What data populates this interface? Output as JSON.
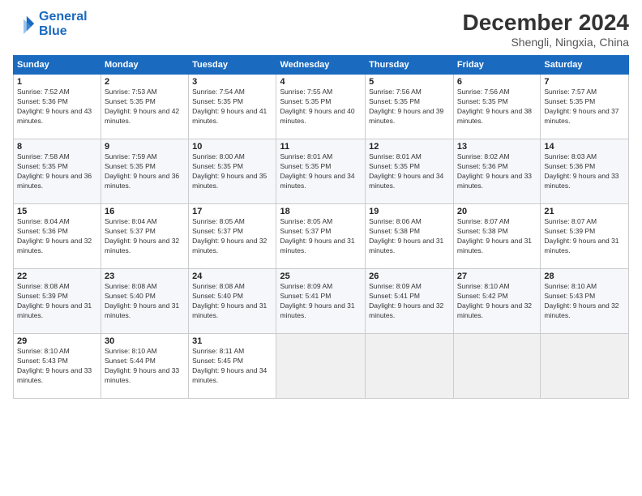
{
  "logo": {
    "line1": "General",
    "line2": "Blue"
  },
  "title": "December 2024",
  "subtitle": "Shengli, Ningxia, China",
  "days_header": [
    "Sunday",
    "Monday",
    "Tuesday",
    "Wednesday",
    "Thursday",
    "Friday",
    "Saturday"
  ],
  "weeks": [
    [
      {
        "day": "1",
        "sunrise": "7:52 AM",
        "sunset": "5:36 PM",
        "daylight": "9 hours and 43 minutes."
      },
      {
        "day": "2",
        "sunrise": "7:53 AM",
        "sunset": "5:35 PM",
        "daylight": "9 hours and 42 minutes."
      },
      {
        "day": "3",
        "sunrise": "7:54 AM",
        "sunset": "5:35 PM",
        "daylight": "9 hours and 41 minutes."
      },
      {
        "day": "4",
        "sunrise": "7:55 AM",
        "sunset": "5:35 PM",
        "daylight": "9 hours and 40 minutes."
      },
      {
        "day": "5",
        "sunrise": "7:56 AM",
        "sunset": "5:35 PM",
        "daylight": "9 hours and 39 minutes."
      },
      {
        "day": "6",
        "sunrise": "7:56 AM",
        "sunset": "5:35 PM",
        "daylight": "9 hours and 38 minutes."
      },
      {
        "day": "7",
        "sunrise": "7:57 AM",
        "sunset": "5:35 PM",
        "daylight": "9 hours and 37 minutes."
      }
    ],
    [
      {
        "day": "8",
        "sunrise": "7:58 AM",
        "sunset": "5:35 PM",
        "daylight": "9 hours and 36 minutes."
      },
      {
        "day": "9",
        "sunrise": "7:59 AM",
        "sunset": "5:35 PM",
        "daylight": "9 hours and 36 minutes."
      },
      {
        "day": "10",
        "sunrise": "8:00 AM",
        "sunset": "5:35 PM",
        "daylight": "9 hours and 35 minutes."
      },
      {
        "day": "11",
        "sunrise": "8:01 AM",
        "sunset": "5:35 PM",
        "daylight": "9 hours and 34 minutes."
      },
      {
        "day": "12",
        "sunrise": "8:01 AM",
        "sunset": "5:35 PM",
        "daylight": "9 hours and 34 minutes."
      },
      {
        "day": "13",
        "sunrise": "8:02 AM",
        "sunset": "5:36 PM",
        "daylight": "9 hours and 33 minutes."
      },
      {
        "day": "14",
        "sunrise": "8:03 AM",
        "sunset": "5:36 PM",
        "daylight": "9 hours and 33 minutes."
      }
    ],
    [
      {
        "day": "15",
        "sunrise": "8:04 AM",
        "sunset": "5:36 PM",
        "daylight": "9 hours and 32 minutes."
      },
      {
        "day": "16",
        "sunrise": "8:04 AM",
        "sunset": "5:37 PM",
        "daylight": "9 hours and 32 minutes."
      },
      {
        "day": "17",
        "sunrise": "8:05 AM",
        "sunset": "5:37 PM",
        "daylight": "9 hours and 32 minutes."
      },
      {
        "day": "18",
        "sunrise": "8:05 AM",
        "sunset": "5:37 PM",
        "daylight": "9 hours and 31 minutes."
      },
      {
        "day": "19",
        "sunrise": "8:06 AM",
        "sunset": "5:38 PM",
        "daylight": "9 hours and 31 minutes."
      },
      {
        "day": "20",
        "sunrise": "8:07 AM",
        "sunset": "5:38 PM",
        "daylight": "9 hours and 31 minutes."
      },
      {
        "day": "21",
        "sunrise": "8:07 AM",
        "sunset": "5:39 PM",
        "daylight": "9 hours and 31 minutes."
      }
    ],
    [
      {
        "day": "22",
        "sunrise": "8:08 AM",
        "sunset": "5:39 PM",
        "daylight": "9 hours and 31 minutes."
      },
      {
        "day": "23",
        "sunrise": "8:08 AM",
        "sunset": "5:40 PM",
        "daylight": "9 hours and 31 minutes."
      },
      {
        "day": "24",
        "sunrise": "8:08 AM",
        "sunset": "5:40 PM",
        "daylight": "9 hours and 31 minutes."
      },
      {
        "day": "25",
        "sunrise": "8:09 AM",
        "sunset": "5:41 PM",
        "daylight": "9 hours and 31 minutes."
      },
      {
        "day": "26",
        "sunrise": "8:09 AM",
        "sunset": "5:41 PM",
        "daylight": "9 hours and 32 minutes."
      },
      {
        "day": "27",
        "sunrise": "8:10 AM",
        "sunset": "5:42 PM",
        "daylight": "9 hours and 32 minutes."
      },
      {
        "day": "28",
        "sunrise": "8:10 AM",
        "sunset": "5:43 PM",
        "daylight": "9 hours and 32 minutes."
      }
    ],
    [
      {
        "day": "29",
        "sunrise": "8:10 AM",
        "sunset": "5:43 PM",
        "daylight": "9 hours and 33 minutes."
      },
      {
        "day": "30",
        "sunrise": "8:10 AM",
        "sunset": "5:44 PM",
        "daylight": "9 hours and 33 minutes."
      },
      {
        "day": "31",
        "sunrise": "8:11 AM",
        "sunset": "5:45 PM",
        "daylight": "9 hours and 34 minutes."
      },
      null,
      null,
      null,
      null
    ]
  ]
}
